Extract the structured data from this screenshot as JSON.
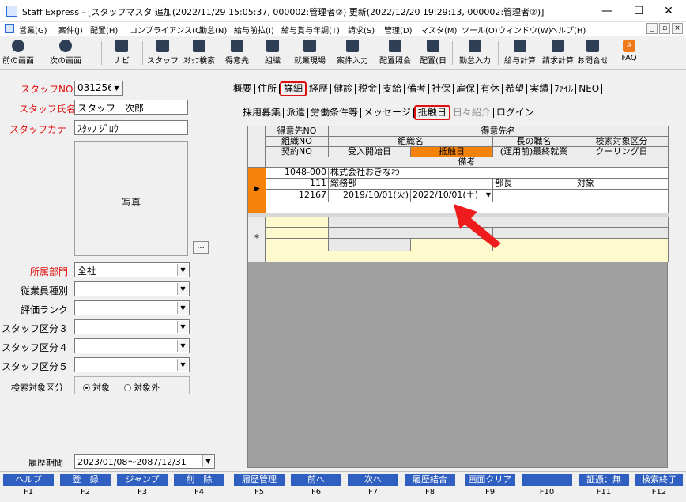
{
  "window": {
    "title": "Staff Express - [スタッフマスタ 追加(2022/11/29 15:05:37, 000002:管理者②) 更新(2022/12/20 19:29:13, 000002:管理者②)]",
    "minimize": "—",
    "maximize": "☐",
    "close": "✕"
  },
  "menu": [
    "営業(G)",
    "案件(J)",
    "配置(H)",
    "コンプライアンス(C)",
    "勤怠(N)",
    "給与前払(I)",
    "給与賞与年調(T)",
    "請求(S)",
    "管理(D)",
    "マスタ(M)",
    "ツール(O)",
    "ウィンドウ(W)",
    "ヘルプ(H)"
  ],
  "toolbar": [
    "前の画面",
    "次の画面",
    "ナビ",
    "スタッフ",
    "ｽﾀｯﾌ検索",
    "得意先",
    "組織",
    "就業現場",
    "案件入力",
    "配置照会",
    "配置(日",
    "勤怠入力",
    "給与計算",
    "請求計算",
    "お問合せ",
    "FAQ"
  ],
  "left": {
    "staff_no_label": "スタッフNO",
    "staff_no": "031256",
    "staff_name_label": "スタッフ氏名",
    "staff_name": "スタッフ　次郎",
    "staff_kana_label": "スタッフカナ",
    "staff_kana": "ｽﾀｯﾌ ｼﾞﾛｳ",
    "photo_label": "写真",
    "photo_button": "...",
    "dept_label": "所属部門",
    "dept": "全社",
    "emp_type_label": "従業員種別",
    "rank_label": "評価ランク",
    "kubun3_label": "スタッフ区分３",
    "kubun4_label": "スタッフ区分４",
    "kubun5_label": "スタッフ区分５",
    "search_label": "検索対象区分",
    "radio_on": "対象",
    "radio_off": "対象外",
    "period_label": "履歴期間",
    "period": "2023/01/08〜2087/12/31"
  },
  "tabs_main": [
    "概要",
    "住所",
    "詳細",
    "経歴",
    "健診",
    "税金",
    "支給",
    "備考",
    "社保",
    "雇保",
    "有休",
    "希望",
    "実績",
    "ﾌｧｲﾙ",
    "NEO"
  ],
  "tabs_sub": [
    "採用募集",
    "派遣",
    "労働条件等",
    "メッセージ",
    "抵触日",
    "日々紹介",
    "ログイン"
  ],
  "grid": {
    "h1": [
      "得意先NO",
      "得意先名"
    ],
    "h2": [
      "組織NO",
      "組織名",
      "長の職名",
      "検索対象区分"
    ],
    "h3": [
      "契約NO",
      "受入開始日",
      "抵触日",
      "(運用前)最終就業",
      "クーリング日"
    ],
    "h4": "備考",
    "row": {
      "client_no": "1048-000",
      "client_name": "株式会社おきなわ",
      "org_no": "111",
      "org_name": "総務部",
      "title": "部長",
      "search": "対象",
      "contract_no": "12167",
      "start_date": "2019/10/01(火)",
      "conflict_date": "2022/10/01(土)",
      "last_work": "",
      "cooling": ""
    },
    "new_marker": "*"
  },
  "fkeys": [
    {
      "label": "ヘルプ",
      "key": "F1"
    },
    {
      "label": "登　録",
      "key": "F2"
    },
    {
      "label": "ジャンプ",
      "key": "F3"
    },
    {
      "label": "削　除",
      "key": "F4"
    },
    {
      "label": "履歴管理",
      "key": "F5"
    },
    {
      "label": "前へ",
      "key": "F6"
    },
    {
      "label": "次へ",
      "key": "F7"
    },
    {
      "label": "履歴結合",
      "key": "F8"
    },
    {
      "label": "画面クリア",
      "key": "F9"
    },
    {
      "label": "",
      "key": "F10"
    },
    {
      "label": "証憑：無",
      "key": "F11"
    },
    {
      "label": "検索終了",
      "key": "F12"
    }
  ],
  "colors": {
    "accent": "#e01010",
    "header_orange": "#f5820a",
    "fkey_blue": "#2f5fc0",
    "new_row": "#fffacd"
  }
}
